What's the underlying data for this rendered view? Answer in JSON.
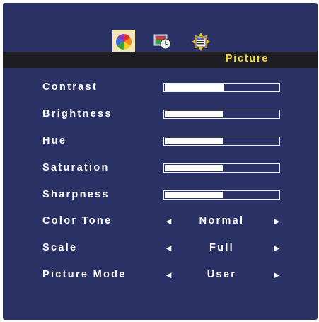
{
  "osd": {
    "tabs": [
      {
        "icon": "color-wheel-icon",
        "selected": true
      },
      {
        "icon": "clock-screen-icon",
        "selected": false
      },
      {
        "icon": "settings-menu-icon",
        "selected": false
      }
    ],
    "title": "Picture",
    "sliders": [
      {
        "label": "Contrast",
        "value": 0.52
      },
      {
        "label": "Brightness",
        "value": 0.51
      },
      {
        "label": "Hue",
        "value": 0.51
      },
      {
        "label": "Saturation",
        "value": 0.51
      },
      {
        "label": "Sharpness",
        "value": 0.51
      }
    ],
    "selectors": [
      {
        "label": "Color Tone",
        "value": "Normal"
      },
      {
        "label": "Scale",
        "value": "Full"
      },
      {
        "label": "Picture Mode",
        "value": "User"
      }
    ],
    "arrow_left": "◄",
    "arrow_right": "►",
    "colors": {
      "background": "#2a3165",
      "title": "#f1dc36",
      "titlebar": "#1e1e22",
      "selected_tab": "#f2e6b4"
    }
  }
}
